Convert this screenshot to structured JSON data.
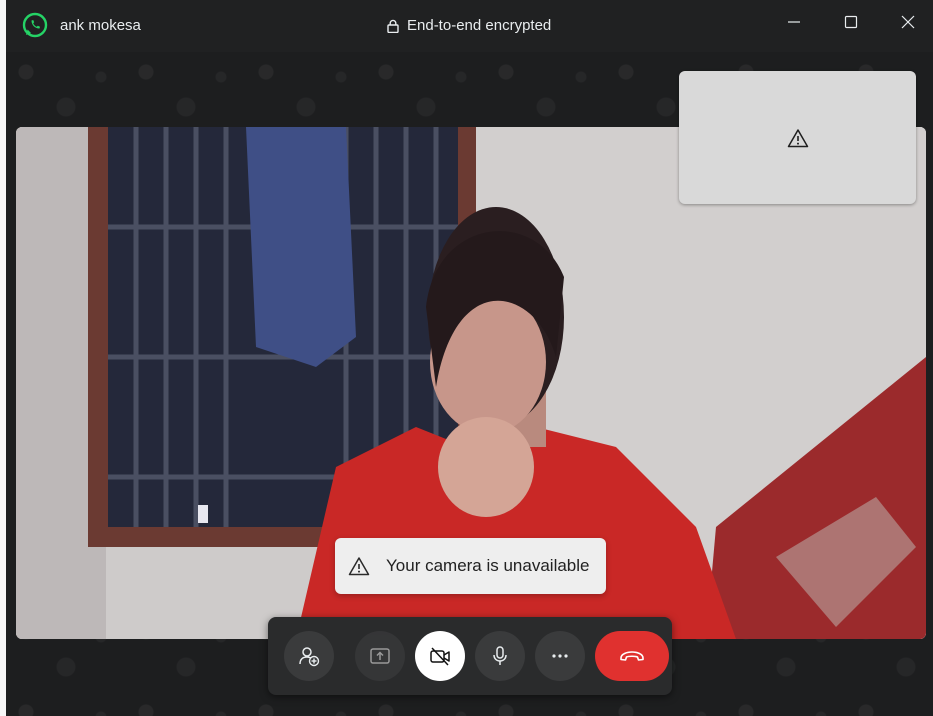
{
  "window": {
    "contact_name": "ank mokesa",
    "encryption_label": "End-to-end encrypted"
  },
  "icons": {
    "app": "whatsapp-logo-icon",
    "lock": "lock-icon",
    "minimize": "minimize-icon",
    "maximize": "maximize-icon",
    "close": "close-icon",
    "warning": "warning-icon"
  },
  "self_view": {
    "icon": "warning-icon"
  },
  "toast": {
    "message": "Your camera is unavailable"
  },
  "controls": [
    {
      "name": "add-participant-button",
      "icon": "add-person-icon"
    },
    {
      "name": "share-screen-button",
      "icon": "share-screen-icon"
    },
    {
      "name": "camera-off-button",
      "icon": "camera-off-icon"
    },
    {
      "name": "microphone-button",
      "icon": "microphone-icon"
    },
    {
      "name": "more-options-button",
      "icon": "more-icon"
    },
    {
      "name": "end-call-button",
      "icon": "end-call-icon"
    }
  ],
  "colors": {
    "brand_green": "#25d366",
    "end_call_red": "#e0312f",
    "title_bar": "#202122"
  }
}
